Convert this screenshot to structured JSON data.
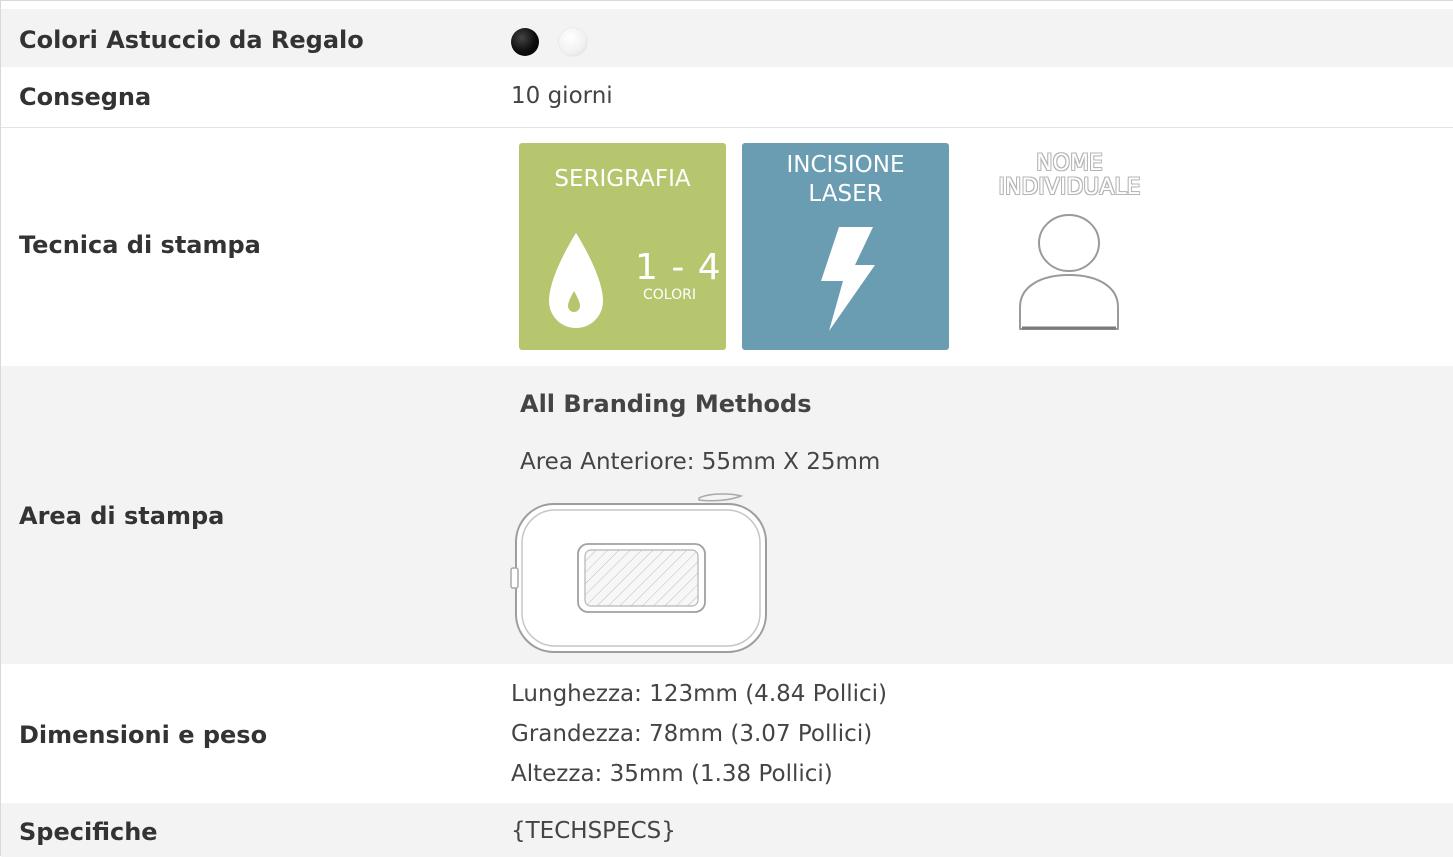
{
  "rows": {
    "colors": {
      "label": "Colori Astuccio da Regalo",
      "swatches": [
        {
          "name": "black",
          "color": "#000000"
        },
        {
          "name": "white",
          "color": "#ffffff"
        }
      ]
    },
    "delivery": {
      "label": "Consegna",
      "value": "10 giorni"
    },
    "technique": {
      "label": "Tecnica di stampa",
      "methods": [
        {
          "title": "SERIGRAFIA",
          "number": "1 - 4",
          "unit": "COLORI",
          "icon": "ink-drop-icon",
          "color": "#b6c66f"
        },
        {
          "title_line1": "INCISIONE",
          "title_line2": "LASER",
          "icon": "lightning-bolt-icon",
          "color": "#6a9db2"
        },
        {
          "title_line1": "NOME",
          "title_line2": "INDIVIDUALE",
          "icon": "person-icon"
        }
      ]
    },
    "print_area": {
      "label": "Area di stampa",
      "heading": "All Branding Methods",
      "text": "Area Anteriore: 55mm X 25mm",
      "icon": "product-case-outline-icon"
    },
    "dimensions": {
      "label": "Dimensioni e peso",
      "lines": [
        "Lunghezza: 123mm (4.84 Pollici)",
        "Grandezza: 78mm (3.07 Pollici)",
        "Altezza: 35mm (1.38 Pollici)"
      ]
    },
    "specs": {
      "label": "Specifiche",
      "value": "{TECHSPECS}"
    }
  },
  "colors": {
    "row_shade": "#f3f3f3",
    "serigrafia": "#b6c66f",
    "laser": "#6a9db2",
    "text": "#444444"
  }
}
